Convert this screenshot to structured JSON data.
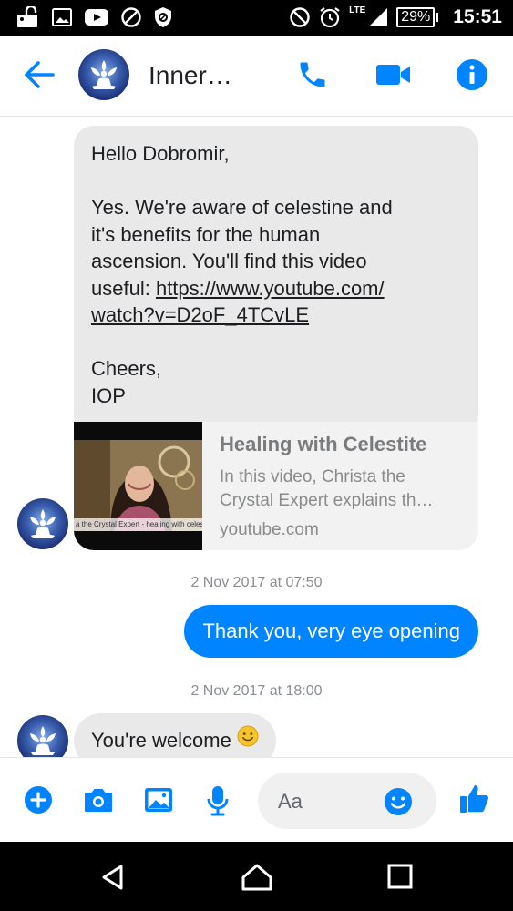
{
  "status_bar": {
    "network": "LTE",
    "battery": "29%",
    "time": "15:51"
  },
  "header": {
    "contact_name": "Inner…"
  },
  "conversation": {
    "first_message": {
      "lines": [
        "Hello Dobromir,",
        "",
        "Yes. We're aware of celestine and",
        "it's benefits for the human",
        "ascension. You'll find this video",
        "useful:"
      ],
      "link_line1": "https://www.youtube.com/",
      "link_line2": "watch?v=D2oF_4TCvLE",
      "closing": "Cheers,",
      "signature": "IOP"
    },
    "link_preview": {
      "title": "Healing with Celestite",
      "description_line1": "In this video, Christa the",
      "description_line2": "Crystal Expert explains th…",
      "domain": "youtube.com",
      "thumb_caption": "a the Crystal Expert - healing with celestite"
    },
    "timestamp1": "2 Nov 2017 at 07:50",
    "outgoing_message": "Thank you, very eye opening",
    "timestamp2": "2 Nov 2017 at 18:00",
    "reply_message": "You're welcome",
    "reply_emoji": "slightly-smiling-face-emoji"
  },
  "composer": {
    "placeholder": "Aa"
  },
  "colors": {
    "accent": "#0084ff",
    "incoming_bubble": "#e9e9e9",
    "link_card_bg": "#f2f2f2"
  }
}
